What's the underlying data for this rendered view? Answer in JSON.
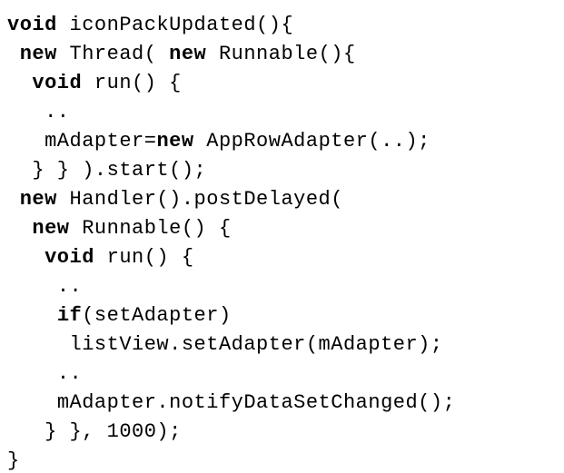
{
  "lines": [
    {
      "indent": 0,
      "tokens": [
        [
          "kw",
          "void"
        ],
        [
          "sp",
          " "
        ],
        [
          "id",
          "iconPackUpdated(){"
        ]
      ]
    },
    {
      "indent": 1,
      "tokens": [
        [
          "kw",
          "new"
        ],
        [
          "sp",
          " "
        ],
        [
          "id",
          "Thread( "
        ],
        [
          "kw",
          "new"
        ],
        [
          "sp",
          " "
        ],
        [
          "id",
          "Runnable(){"
        ]
      ]
    },
    {
      "indent": 2,
      "tokens": [
        [
          "kw",
          "void"
        ],
        [
          "sp",
          " "
        ],
        [
          "id",
          "run() {"
        ]
      ]
    },
    {
      "indent": 3,
      "tokens": [
        [
          "id",
          ".."
        ]
      ]
    },
    {
      "indent": 3,
      "tokens": [
        [
          "id",
          "mAdapter="
        ],
        [
          "kw",
          "new"
        ],
        [
          "sp",
          " "
        ],
        [
          "id",
          "AppRowAdapter(..);"
        ]
      ]
    },
    {
      "indent": 2,
      "tokens": [
        [
          "id",
          "} } ).start();"
        ]
      ]
    },
    {
      "indent": 1,
      "tokens": [
        [
          "kw",
          "new"
        ],
        [
          "sp",
          " "
        ],
        [
          "id",
          "Handler().postDelayed("
        ]
      ]
    },
    {
      "indent": 2,
      "tokens": [
        [
          "kw",
          "new"
        ],
        [
          "sp",
          " "
        ],
        [
          "id",
          "Runnable() {"
        ]
      ]
    },
    {
      "indent": 3,
      "tokens": [
        [
          "kw",
          "void"
        ],
        [
          "sp",
          " "
        ],
        [
          "id",
          "run() {"
        ]
      ]
    },
    {
      "indent": 4,
      "tokens": [
        [
          "id",
          ".."
        ]
      ]
    },
    {
      "indent": 4,
      "tokens": [
        [
          "kw",
          "if"
        ],
        [
          "id",
          "(setAdapter)"
        ]
      ]
    },
    {
      "indent": 5,
      "tokens": [
        [
          "id",
          "listView.setAdapter(mAdapter);"
        ]
      ]
    },
    {
      "indent": 4,
      "tokens": [
        [
          "id",
          ".."
        ]
      ]
    },
    {
      "indent": 4,
      "tokens": [
        [
          "id",
          "mAdapter.notifyDataSetChanged();"
        ]
      ]
    },
    {
      "indent": 3,
      "tokens": [
        [
          "id",
          "} }, 1000);"
        ]
      ]
    },
    {
      "indent": 0,
      "tokens": [
        [
          "id",
          "}"
        ]
      ]
    }
  ],
  "indent_unit": " "
}
